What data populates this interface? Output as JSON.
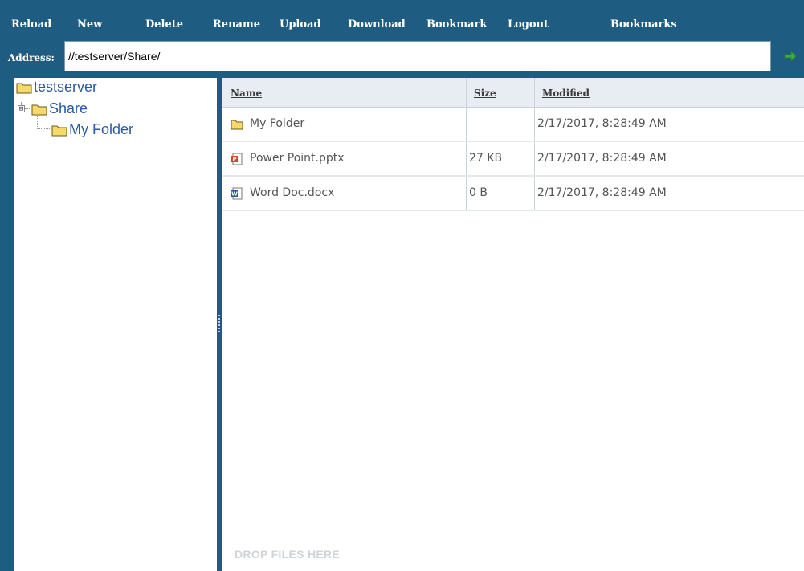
{
  "toolbar": {
    "reload": "Reload",
    "new": "New",
    "delete": "Delete",
    "rename": "Rename",
    "upload": "Upload",
    "download": "Download",
    "bookmark": "Bookmark",
    "logout": "Logout",
    "bookmarks": "Bookmarks"
  },
  "address": {
    "label": "Address:",
    "value": "//testserver/Share/",
    "go_icon": "green-arrow-icon"
  },
  "tree": {
    "root": {
      "label": "testserver",
      "icon": "folder-icon"
    },
    "share": {
      "label": "Share",
      "icon": "folder-icon",
      "expander": "⊟"
    },
    "my_folder": {
      "label": "My Folder",
      "icon": "folder-icon"
    }
  },
  "file_list": {
    "columns": [
      "Name",
      "Size",
      "Modified"
    ],
    "rows": [
      {
        "name": "My Folder",
        "size": "",
        "modified": "2/17/2017, 8:28:49 AM",
        "icon": "folder-icon"
      },
      {
        "name": "Power Point.pptx",
        "size": "27 KB",
        "modified": "2/17/2017, 8:28:49 AM",
        "icon": "powerpoint-file-icon"
      },
      {
        "name": "Word Doc.docx",
        "size": "0 B",
        "modified": "2/17/2017, 8:28:49 AM",
        "icon": "word-file-icon"
      }
    ],
    "drop_hint": "DROP FILES HERE"
  },
  "colors": {
    "chrome": "#1f5c82",
    "tree_link": "#2a5aa0",
    "header_bg": "#e7edf2",
    "folder_yellow": "#f7d96a"
  }
}
